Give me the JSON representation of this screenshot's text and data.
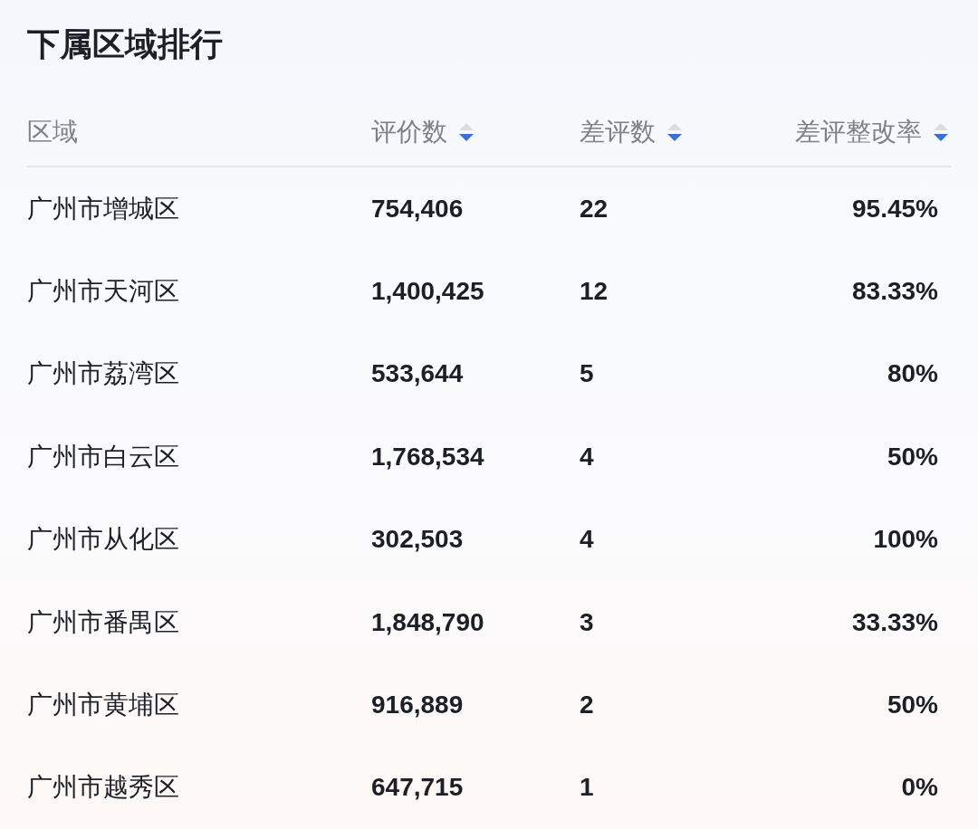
{
  "title": "下属区域排行",
  "columns": [
    {
      "label": "区域",
      "sortable": false
    },
    {
      "label": "评价数",
      "sortable": true
    },
    {
      "label": "差评数",
      "sortable": true
    },
    {
      "label": "差评整改率",
      "sortable": true
    }
  ],
  "rows": [
    [
      "广州市增城区",
      "754,406",
      "22",
      "95.45%"
    ],
    [
      "广州市天河区",
      "1,400,425",
      "12",
      "83.33%"
    ],
    [
      "广州市荔湾区",
      "533,644",
      "5",
      "80%"
    ],
    [
      "广州市白云区",
      "1,768,534",
      "4",
      "50%"
    ],
    [
      "广州市从化区",
      "302,503",
      "4",
      "100%"
    ],
    [
      "广州市番禺区",
      "1,848,790",
      "3",
      "33.33%"
    ],
    [
      "广州市黄埔区",
      "916,889",
      "2",
      "50%"
    ],
    [
      "广州市越秀区",
      "647,715",
      "1",
      "0%"
    ]
  ]
}
